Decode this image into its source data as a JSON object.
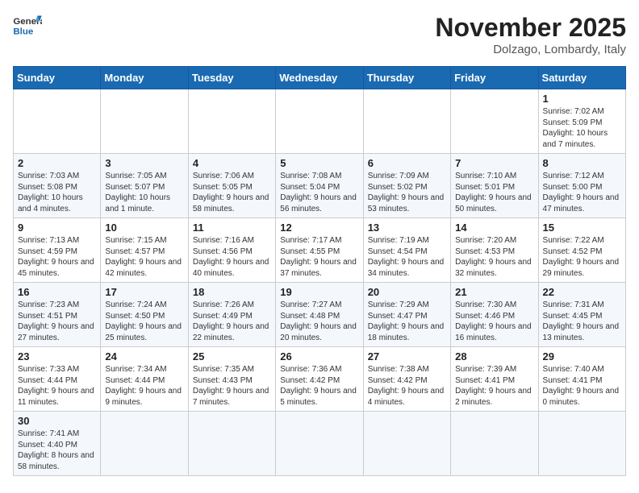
{
  "header": {
    "logo_general": "General",
    "logo_blue": "Blue",
    "month": "November 2025",
    "location": "Dolzago, Lombardy, Italy"
  },
  "days_of_week": [
    "Sunday",
    "Monday",
    "Tuesday",
    "Wednesday",
    "Thursday",
    "Friday",
    "Saturday"
  ],
  "weeks": [
    [
      {
        "day": "",
        "info": ""
      },
      {
        "day": "",
        "info": ""
      },
      {
        "day": "",
        "info": ""
      },
      {
        "day": "",
        "info": ""
      },
      {
        "day": "",
        "info": ""
      },
      {
        "day": "",
        "info": ""
      },
      {
        "day": "1",
        "info": "Sunrise: 7:02 AM\nSunset: 5:09 PM\nDaylight: 10 hours and 7 minutes."
      }
    ],
    [
      {
        "day": "2",
        "info": "Sunrise: 7:03 AM\nSunset: 5:08 PM\nDaylight: 10 hours and 4 minutes."
      },
      {
        "day": "3",
        "info": "Sunrise: 7:05 AM\nSunset: 5:07 PM\nDaylight: 10 hours and 1 minute."
      },
      {
        "day": "4",
        "info": "Sunrise: 7:06 AM\nSunset: 5:05 PM\nDaylight: 9 hours and 58 minutes."
      },
      {
        "day": "5",
        "info": "Sunrise: 7:08 AM\nSunset: 5:04 PM\nDaylight: 9 hours and 56 minutes."
      },
      {
        "day": "6",
        "info": "Sunrise: 7:09 AM\nSunset: 5:02 PM\nDaylight: 9 hours and 53 minutes."
      },
      {
        "day": "7",
        "info": "Sunrise: 7:10 AM\nSunset: 5:01 PM\nDaylight: 9 hours and 50 minutes."
      },
      {
        "day": "8",
        "info": "Sunrise: 7:12 AM\nSunset: 5:00 PM\nDaylight: 9 hours and 47 minutes."
      }
    ],
    [
      {
        "day": "9",
        "info": "Sunrise: 7:13 AM\nSunset: 4:59 PM\nDaylight: 9 hours and 45 minutes."
      },
      {
        "day": "10",
        "info": "Sunrise: 7:15 AM\nSunset: 4:57 PM\nDaylight: 9 hours and 42 minutes."
      },
      {
        "day": "11",
        "info": "Sunrise: 7:16 AM\nSunset: 4:56 PM\nDaylight: 9 hours and 40 minutes."
      },
      {
        "day": "12",
        "info": "Sunrise: 7:17 AM\nSunset: 4:55 PM\nDaylight: 9 hours and 37 minutes."
      },
      {
        "day": "13",
        "info": "Sunrise: 7:19 AM\nSunset: 4:54 PM\nDaylight: 9 hours and 34 minutes."
      },
      {
        "day": "14",
        "info": "Sunrise: 7:20 AM\nSunset: 4:53 PM\nDaylight: 9 hours and 32 minutes."
      },
      {
        "day": "15",
        "info": "Sunrise: 7:22 AM\nSunset: 4:52 PM\nDaylight: 9 hours and 29 minutes."
      }
    ],
    [
      {
        "day": "16",
        "info": "Sunrise: 7:23 AM\nSunset: 4:51 PM\nDaylight: 9 hours and 27 minutes."
      },
      {
        "day": "17",
        "info": "Sunrise: 7:24 AM\nSunset: 4:50 PM\nDaylight: 9 hours and 25 minutes."
      },
      {
        "day": "18",
        "info": "Sunrise: 7:26 AM\nSunset: 4:49 PM\nDaylight: 9 hours and 22 minutes."
      },
      {
        "day": "19",
        "info": "Sunrise: 7:27 AM\nSunset: 4:48 PM\nDaylight: 9 hours and 20 minutes."
      },
      {
        "day": "20",
        "info": "Sunrise: 7:29 AM\nSunset: 4:47 PM\nDaylight: 9 hours and 18 minutes."
      },
      {
        "day": "21",
        "info": "Sunrise: 7:30 AM\nSunset: 4:46 PM\nDaylight: 9 hours and 16 minutes."
      },
      {
        "day": "22",
        "info": "Sunrise: 7:31 AM\nSunset: 4:45 PM\nDaylight: 9 hours and 13 minutes."
      }
    ],
    [
      {
        "day": "23",
        "info": "Sunrise: 7:33 AM\nSunset: 4:44 PM\nDaylight: 9 hours and 11 minutes."
      },
      {
        "day": "24",
        "info": "Sunrise: 7:34 AM\nSunset: 4:44 PM\nDaylight: 9 hours and 9 minutes."
      },
      {
        "day": "25",
        "info": "Sunrise: 7:35 AM\nSunset: 4:43 PM\nDaylight: 9 hours and 7 minutes."
      },
      {
        "day": "26",
        "info": "Sunrise: 7:36 AM\nSunset: 4:42 PM\nDaylight: 9 hours and 5 minutes."
      },
      {
        "day": "27",
        "info": "Sunrise: 7:38 AM\nSunset: 4:42 PM\nDaylight: 9 hours and 4 minutes."
      },
      {
        "day": "28",
        "info": "Sunrise: 7:39 AM\nSunset: 4:41 PM\nDaylight: 9 hours and 2 minutes."
      },
      {
        "day": "29",
        "info": "Sunrise: 7:40 AM\nSunset: 4:41 PM\nDaylight: 9 hours and 0 minutes."
      }
    ],
    [
      {
        "day": "30",
        "info": "Sunrise: 7:41 AM\nSunset: 4:40 PM\nDaylight: 8 hours and 58 minutes."
      },
      {
        "day": "",
        "info": ""
      },
      {
        "day": "",
        "info": ""
      },
      {
        "day": "",
        "info": ""
      },
      {
        "day": "",
        "info": ""
      },
      {
        "day": "",
        "info": ""
      },
      {
        "day": "",
        "info": ""
      }
    ]
  ]
}
